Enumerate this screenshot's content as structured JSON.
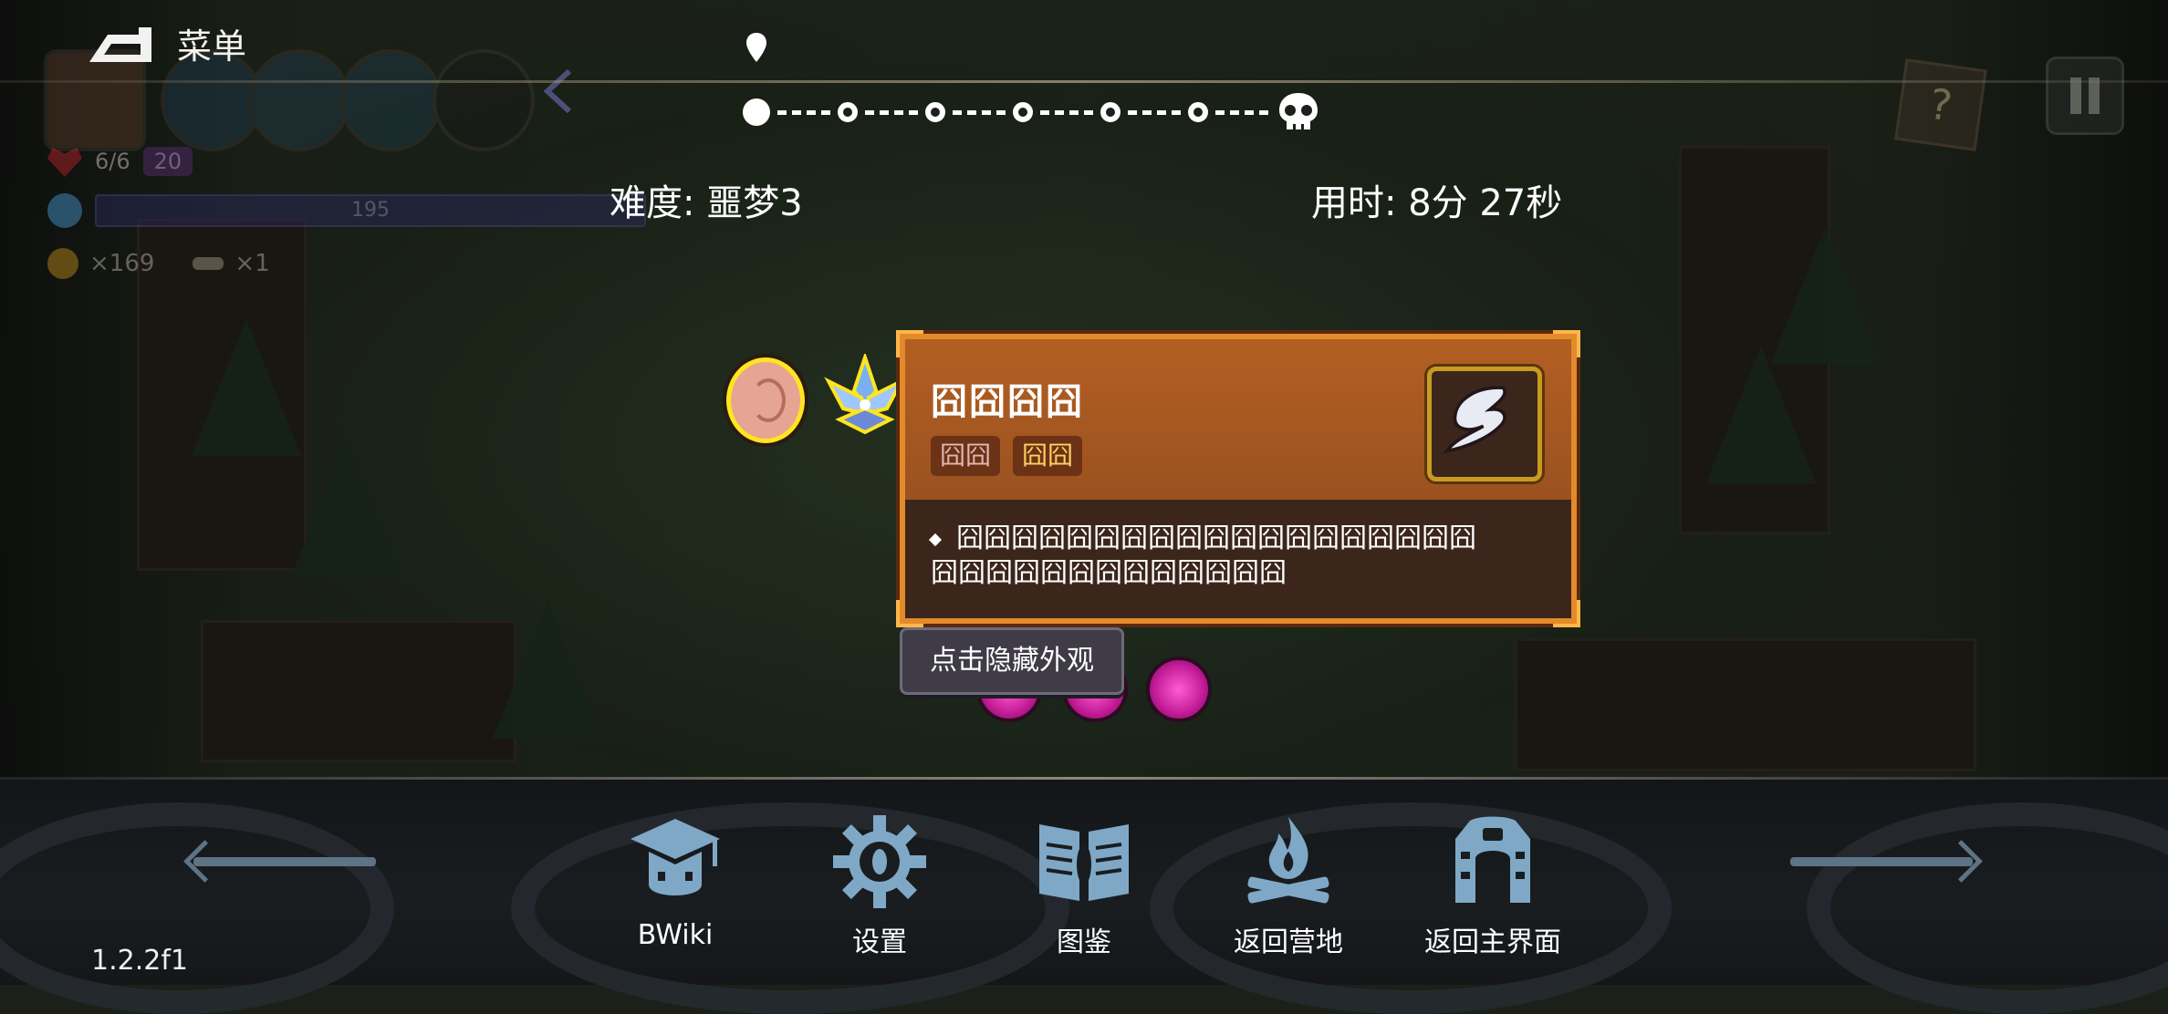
{
  "header": {
    "menu_label": "菜单"
  },
  "hud": {
    "hp": "6/6",
    "shield": "20",
    "mana": "195",
    "coins": "×169",
    "keys": "×1"
  },
  "progress": {
    "nodes": 7,
    "current": 0,
    "boss_icon": "skull-icon"
  },
  "run_info": {
    "difficulty": "难度: 噩梦3",
    "time": "用时: 8分 27秒"
  },
  "tooltip": {
    "title": "囧囧囧囧",
    "tags": [
      "囧囧",
      "囧囧"
    ],
    "description_line1": "囧囧囧囧囧囧囧囧囧囧囧囧囧囧囧囧囧囧囧",
    "description_line2": "囧囧囧囧囧囧囧囧囧囧囧囧囧",
    "icon": "whip-slash-icon",
    "hide_button": "点击隐藏外观"
  },
  "bottom_nav": [
    {
      "label": "BWiki",
      "icon": "graduation-cap-icon"
    },
    {
      "label": "设置",
      "icon": "gear-icon"
    },
    {
      "label": "图鉴",
      "icon": "book-icon"
    },
    {
      "label": "返回营地",
      "icon": "campfire-icon"
    },
    {
      "label": "返回主界面",
      "icon": "gate-icon"
    }
  ],
  "version": "1.2.2f1",
  "colors": {
    "tooltip_bg": "#9d531f",
    "tooltip_border": "#e38a2a",
    "nav_icon": "#7fa8c6",
    "accent_orb": "#c21a96"
  }
}
